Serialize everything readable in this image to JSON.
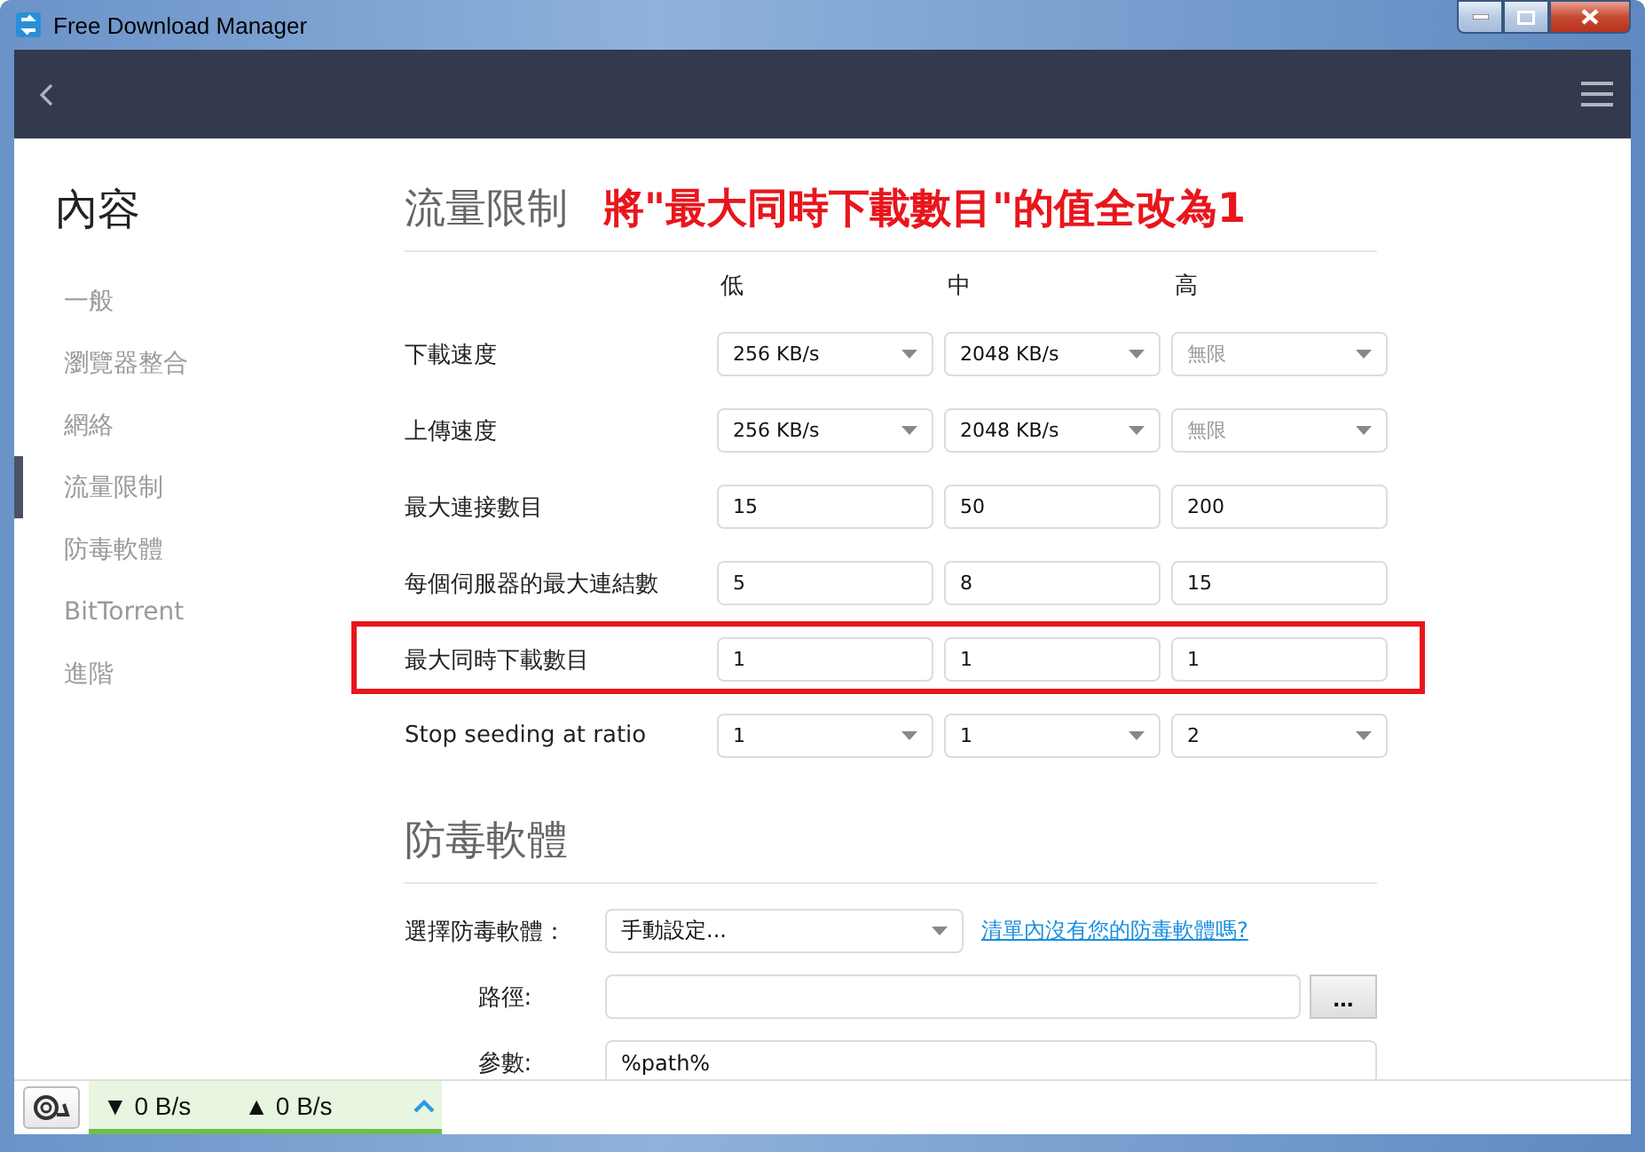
{
  "window": {
    "title": "Free Download Manager"
  },
  "sidebar": {
    "title": "內容",
    "items": [
      {
        "label": "一般",
        "selected": false
      },
      {
        "label": "瀏覽器整合",
        "selected": false
      },
      {
        "label": "網絡",
        "selected": false
      },
      {
        "label": "流量限制",
        "selected": true
      },
      {
        "label": "防毒軟體",
        "selected": false
      },
      {
        "label": "BitTorrent",
        "selected": false
      },
      {
        "label": "進階",
        "selected": false
      }
    ]
  },
  "traffic": {
    "heading": "流量限制",
    "annotation": "將\"最大同時下載數目\"的值全改為1",
    "columns": [
      "低",
      "中",
      "高"
    ],
    "rows": [
      {
        "label": "下載速度",
        "kind": "select",
        "highlighted": false,
        "cells": [
          {
            "value": "256 KB/s",
            "disabled": false
          },
          {
            "value": "2048 KB/s",
            "disabled": false
          },
          {
            "value": "無限",
            "disabled": true
          }
        ]
      },
      {
        "label": "上傳速度",
        "kind": "select",
        "highlighted": false,
        "cells": [
          {
            "value": "256 KB/s",
            "disabled": false
          },
          {
            "value": "2048 KB/s",
            "disabled": false
          },
          {
            "value": "無限",
            "disabled": true
          }
        ]
      },
      {
        "label": "最大連接數目",
        "kind": "input",
        "highlighted": false,
        "cells": [
          {
            "value": "15",
            "disabled": false
          },
          {
            "value": "50",
            "disabled": false
          },
          {
            "value": "200",
            "disabled": false
          }
        ]
      },
      {
        "label": "每個伺服器的最大連結數",
        "kind": "input",
        "highlighted": false,
        "cells": [
          {
            "value": "5",
            "disabled": false
          },
          {
            "value": "8",
            "disabled": false
          },
          {
            "value": "15",
            "disabled": false
          }
        ]
      },
      {
        "label": "最大同時下載數目",
        "kind": "input",
        "highlighted": true,
        "cells": [
          {
            "value": "1",
            "disabled": false
          },
          {
            "value": "1",
            "disabled": false
          },
          {
            "value": "1",
            "disabled": false
          }
        ]
      },
      {
        "label": "Stop seeding at ratio",
        "kind": "select",
        "highlighted": false,
        "cells": [
          {
            "value": "1",
            "disabled": false
          },
          {
            "value": "1",
            "disabled": false
          },
          {
            "value": "2",
            "disabled": false
          }
        ]
      }
    ]
  },
  "antivirus": {
    "heading": "防毒軟體",
    "select_label": "選擇防毒軟體：",
    "select_value": "手動設定...",
    "link": "清單內沒有您的防毒軟體嗎?",
    "path_label": "路徑:",
    "browse_button": "...",
    "args_label": "參數:",
    "args_value": "%path%"
  },
  "status_bar": {
    "download": "▼ 0 B/s",
    "upload": "▲ 0 B/s"
  }
}
